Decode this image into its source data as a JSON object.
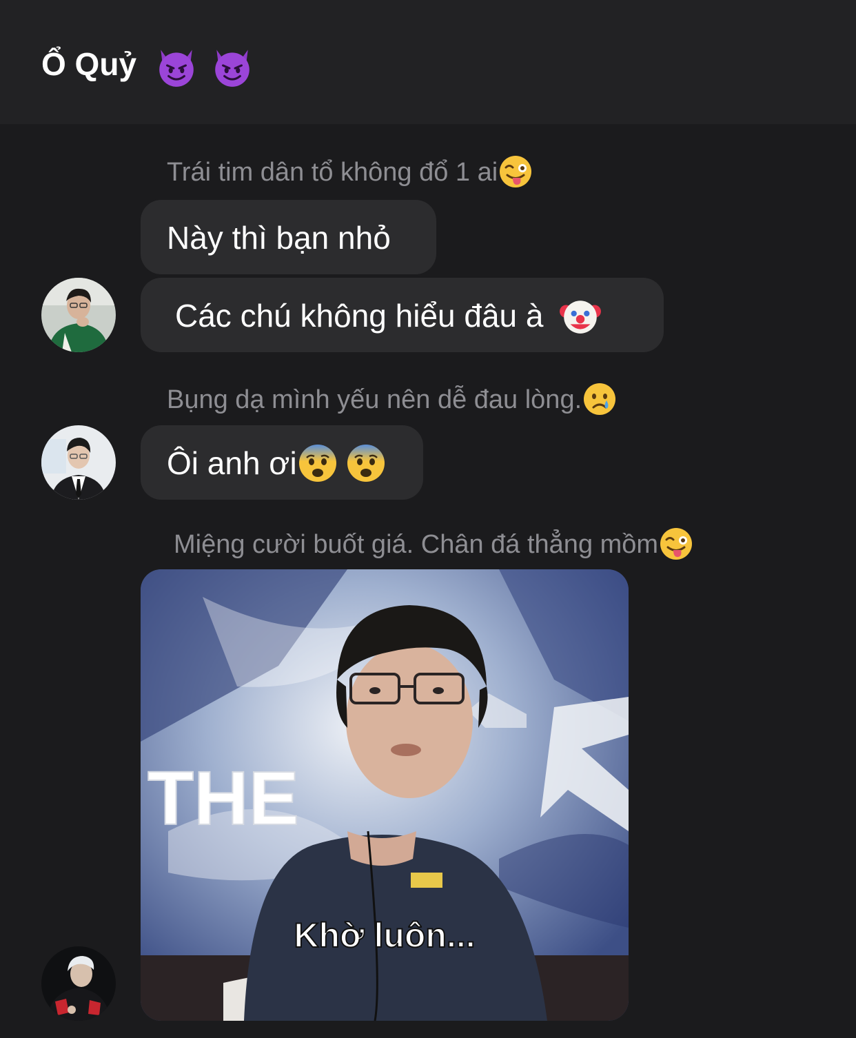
{
  "header": {
    "title": "Ổ Quỷ",
    "title_icons": [
      "smiling-devil-icon",
      "smiling-devil-icon"
    ]
  },
  "messages": [
    {
      "reply_to": "Trái tim dân tổ không đổ 1 ai",
      "reply_emoji": "winking-tongue-face-icon",
      "texts": [
        "Này thì bạn nhỏ",
        "Các chú không hiểu đâu à"
      ],
      "text_emoji": "clown-face-icon"
    },
    {
      "reply_to": "Bụng dạ mình yếu nên dễ đau lòng.",
      "reply_emoji": "crying-face-icon",
      "texts": [
        "Ôi anh ơi"
      ],
      "text_emoji": "anxious-face-icon"
    },
    {
      "reply_to": "Miệng cười buốt giá. Chân đá thẳng mồm",
      "reply_emoji": "winking-tongue-face-icon",
      "image_caption": "Khờ luôn...",
      "image_text": "THE"
    }
  ],
  "colors": {
    "background": "#1b1b1d",
    "header": "#222224",
    "bubble": "#2c2c2e",
    "muted_text": "#8e8e93"
  }
}
